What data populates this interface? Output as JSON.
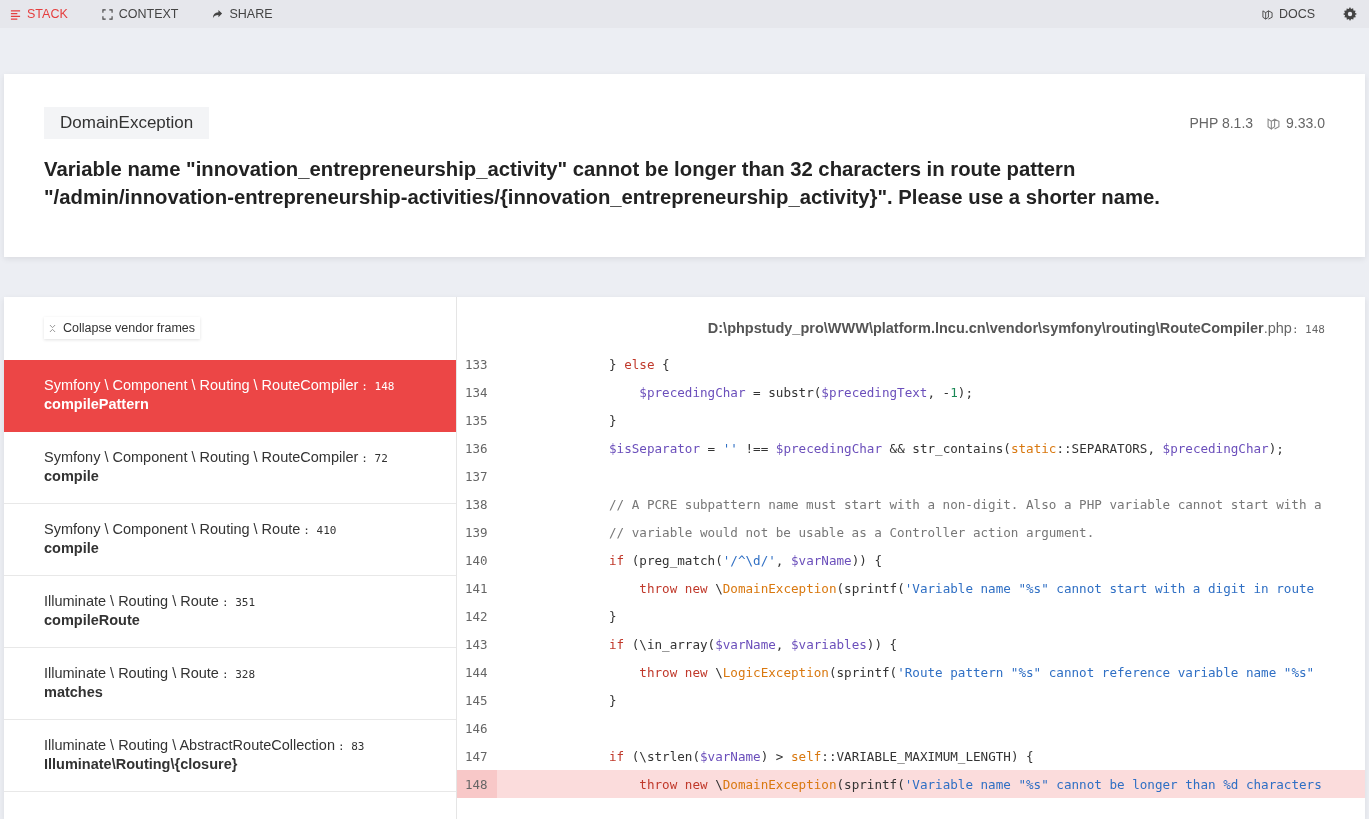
{
  "toolbar": {
    "tabs": [
      {
        "label": "STACK",
        "selected": true
      },
      {
        "label": "CONTEXT",
        "selected": false
      },
      {
        "label": "SHARE",
        "selected": false
      }
    ],
    "docs": "DOCS"
  },
  "exception": {
    "class": "DomainException",
    "php_version": "PHP 8.1.3",
    "laravel_version": "9.33.0",
    "message": "Variable name \"innovation_entrepreneurship_activity\" cannot be longer than 32 characters in route pattern \"/admin/innovation-entrepreneurship-activities/{innovation_entrepreneurship_activity}\". Please use a shorter name."
  },
  "stack": {
    "collapse_button": "Collapse vendor frames",
    "frames": [
      {
        "class": "Symfony \\ Component \\ Routing \\ RouteCompiler",
        "line": ": 148",
        "method": "compilePattern",
        "selected": true
      },
      {
        "class": "Symfony \\ Component \\ Routing \\ RouteCompiler",
        "line": ": 72",
        "method": "compile",
        "selected": false
      },
      {
        "class": "Symfony \\ Component \\ Routing \\ Route",
        "line": ": 410",
        "method": "compile",
        "selected": false
      },
      {
        "class": "Illuminate \\ Routing \\ Route",
        "line": ": 351",
        "method": "compileRoute",
        "selected": false
      },
      {
        "class": "Illuminate \\ Routing \\ Route",
        "line": ": 328",
        "method": "matches",
        "selected": false
      },
      {
        "class": "Illuminate \\ Routing \\ AbstractRouteCollection",
        "line": ": 83",
        "method": "Illuminate\\Routing\\{closure}",
        "selected": false
      }
    ],
    "file": {
      "path": "D:\\phpstudy_pro\\WWW\\platform.lncu.cn\\vendor\\symfony\\routing\\RouteCompiler",
      "extension": ".php",
      "line": ": 148"
    },
    "code": [
      {
        "number": "133",
        "highlighted": false,
        "tokens": [
          {
            "kind": "plain",
            "text": "            } "
          },
          {
            "kind": "keyword",
            "text": "else"
          },
          {
            "kind": "plain",
            "text": " {"
          }
        ]
      },
      {
        "number": "134",
        "highlighted": false,
        "tokens": [
          {
            "kind": "variable",
            "text": "                $precedingChar"
          },
          {
            "kind": "plain",
            "text": " = substr("
          },
          {
            "kind": "variable",
            "text": "$precedingText"
          },
          {
            "kind": "plain",
            "text": ", -"
          },
          {
            "kind": "number",
            "text": "1"
          },
          {
            "kind": "plain",
            "text": ");"
          }
        ]
      },
      {
        "number": "135",
        "highlighted": false,
        "tokens": [
          {
            "kind": "plain",
            "text": "            }"
          }
        ]
      },
      {
        "number": "136",
        "highlighted": false,
        "tokens": [
          {
            "kind": "variable",
            "text": "            $isSeparator"
          },
          {
            "kind": "plain",
            "text": " = "
          },
          {
            "kind": "string",
            "text": "''"
          },
          {
            "kind": "plain",
            "text": " !== "
          },
          {
            "kind": "variable",
            "text": "$precedingChar"
          },
          {
            "kind": "plain",
            "text": " && str_contains("
          },
          {
            "kind": "class",
            "text": "static"
          },
          {
            "kind": "plain",
            "text": "::SEPARATORS, "
          },
          {
            "kind": "variable",
            "text": "$precedingChar"
          },
          {
            "kind": "plain",
            "text": ");"
          }
        ]
      },
      {
        "number": "137",
        "highlighted": false
      },
      {
        "number": "138",
        "highlighted": false,
        "tokens": [
          {
            "kind": "comment",
            "text": "            // A PCRE subpattern name must start with a non-digit. Also a PHP variable cannot start with a"
          }
        ]
      },
      {
        "number": "139",
        "highlighted": false,
        "tokens": [
          {
            "kind": "comment",
            "text": "            // variable would not be usable as a Controller action argument."
          }
        ]
      },
      {
        "number": "140",
        "highlighted": false,
        "tokens": [
          {
            "kind": "keyword",
            "text": "            if"
          },
          {
            "kind": "plain",
            "text": " (preg_match("
          },
          {
            "kind": "string",
            "text": "'/^\\d/'"
          },
          {
            "kind": "plain",
            "text": ", "
          },
          {
            "kind": "variable",
            "text": "$varName"
          },
          {
            "kind": "plain",
            "text": ")) {"
          }
        ]
      },
      {
        "number": "141",
        "highlighted": false,
        "tokens": [
          {
            "kind": "keyword",
            "text": "                throw new"
          },
          {
            "kind": "plain",
            "text": " \\"
          },
          {
            "kind": "class",
            "text": "DomainException"
          },
          {
            "kind": "plain",
            "text": "(sprintf("
          },
          {
            "kind": "string",
            "text": "'Variable name \"%s\" cannot start with a digit in route"
          }
        ]
      },
      {
        "number": "142",
        "highlighted": false,
        "tokens": [
          {
            "kind": "plain",
            "text": "            }"
          }
        ]
      },
      {
        "number": "143",
        "highlighted": false,
        "tokens": [
          {
            "kind": "keyword",
            "text": "            if"
          },
          {
            "kind": "plain",
            "text": " (\\in_array("
          },
          {
            "kind": "variable",
            "text": "$varName"
          },
          {
            "kind": "plain",
            "text": ", "
          },
          {
            "kind": "variable",
            "text": "$variables"
          },
          {
            "kind": "plain",
            "text": ")) {"
          }
        ]
      },
      {
        "number": "144",
        "highlighted": false,
        "tokens": [
          {
            "kind": "keyword",
            "text": "                throw new"
          },
          {
            "kind": "plain",
            "text": " \\"
          },
          {
            "kind": "class",
            "text": "LogicException"
          },
          {
            "kind": "plain",
            "text": "(sprintf("
          },
          {
            "kind": "string",
            "text": "'Route pattern \"%s\" cannot reference variable name \"%s\""
          }
        ]
      },
      {
        "number": "145",
        "highlighted": false,
        "tokens": [
          {
            "kind": "plain",
            "text": "            }"
          }
        ]
      },
      {
        "number": "146",
        "highlighted": false
      },
      {
        "number": "147",
        "highlighted": false,
        "tokens": [
          {
            "kind": "keyword",
            "text": "            if"
          },
          {
            "kind": "plain",
            "text": " (\\strlen("
          },
          {
            "kind": "variable",
            "text": "$varName"
          },
          {
            "kind": "plain",
            "text": ") > "
          },
          {
            "kind": "class",
            "text": "self"
          },
          {
            "kind": "plain",
            "text": "::VARIABLE_MAXIMUM_LENGTH) {"
          }
        ]
      },
      {
        "number": "148",
        "highlighted": true,
        "tokens": [
          {
            "kind": "keyword",
            "text": "                throw new"
          },
          {
            "kind": "plain",
            "text": " \\"
          },
          {
            "kind": "class",
            "text": "DomainException"
          },
          {
            "kind": "plain",
            "text": "(sprintf("
          },
          {
            "kind": "string",
            "text": "'Variable name \"%s\" cannot be longer than %d characters"
          }
        ]
      }
    ]
  }
}
